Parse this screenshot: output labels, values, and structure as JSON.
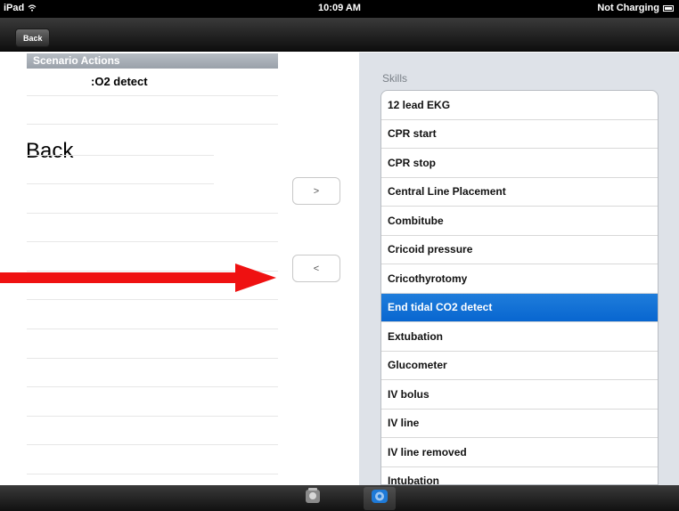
{
  "status_bar": {
    "device": "iPad",
    "time": "10:09 AM",
    "charging": "Not Charging"
  },
  "nav": {
    "back_label": "Back"
  },
  "left_pane": {
    "header": "Scenario Actions",
    "first_row_text": ":O2 detect",
    "overlay_back": "Back"
  },
  "buttons": {
    "add": ">",
    "remove": "<"
  },
  "skills": {
    "title": "Skills",
    "items": [
      "12 lead EKG",
      "CPR start",
      "CPR stop",
      "Central Line Placement",
      "Combitube",
      "Cricoid pressure",
      "Cricothyrotomy",
      "End tidal CO2 detect",
      "Extubation",
      "Glucometer",
      "IV bolus",
      "IV line",
      "IV line removed",
      "Intubation"
    ],
    "selected_index": 7
  },
  "colors": {
    "selection": "#0e6fd4",
    "annotation_arrow": "#ef1111"
  },
  "icons": {
    "tab1": "scenario-icon",
    "tab2": "skills-icon"
  }
}
